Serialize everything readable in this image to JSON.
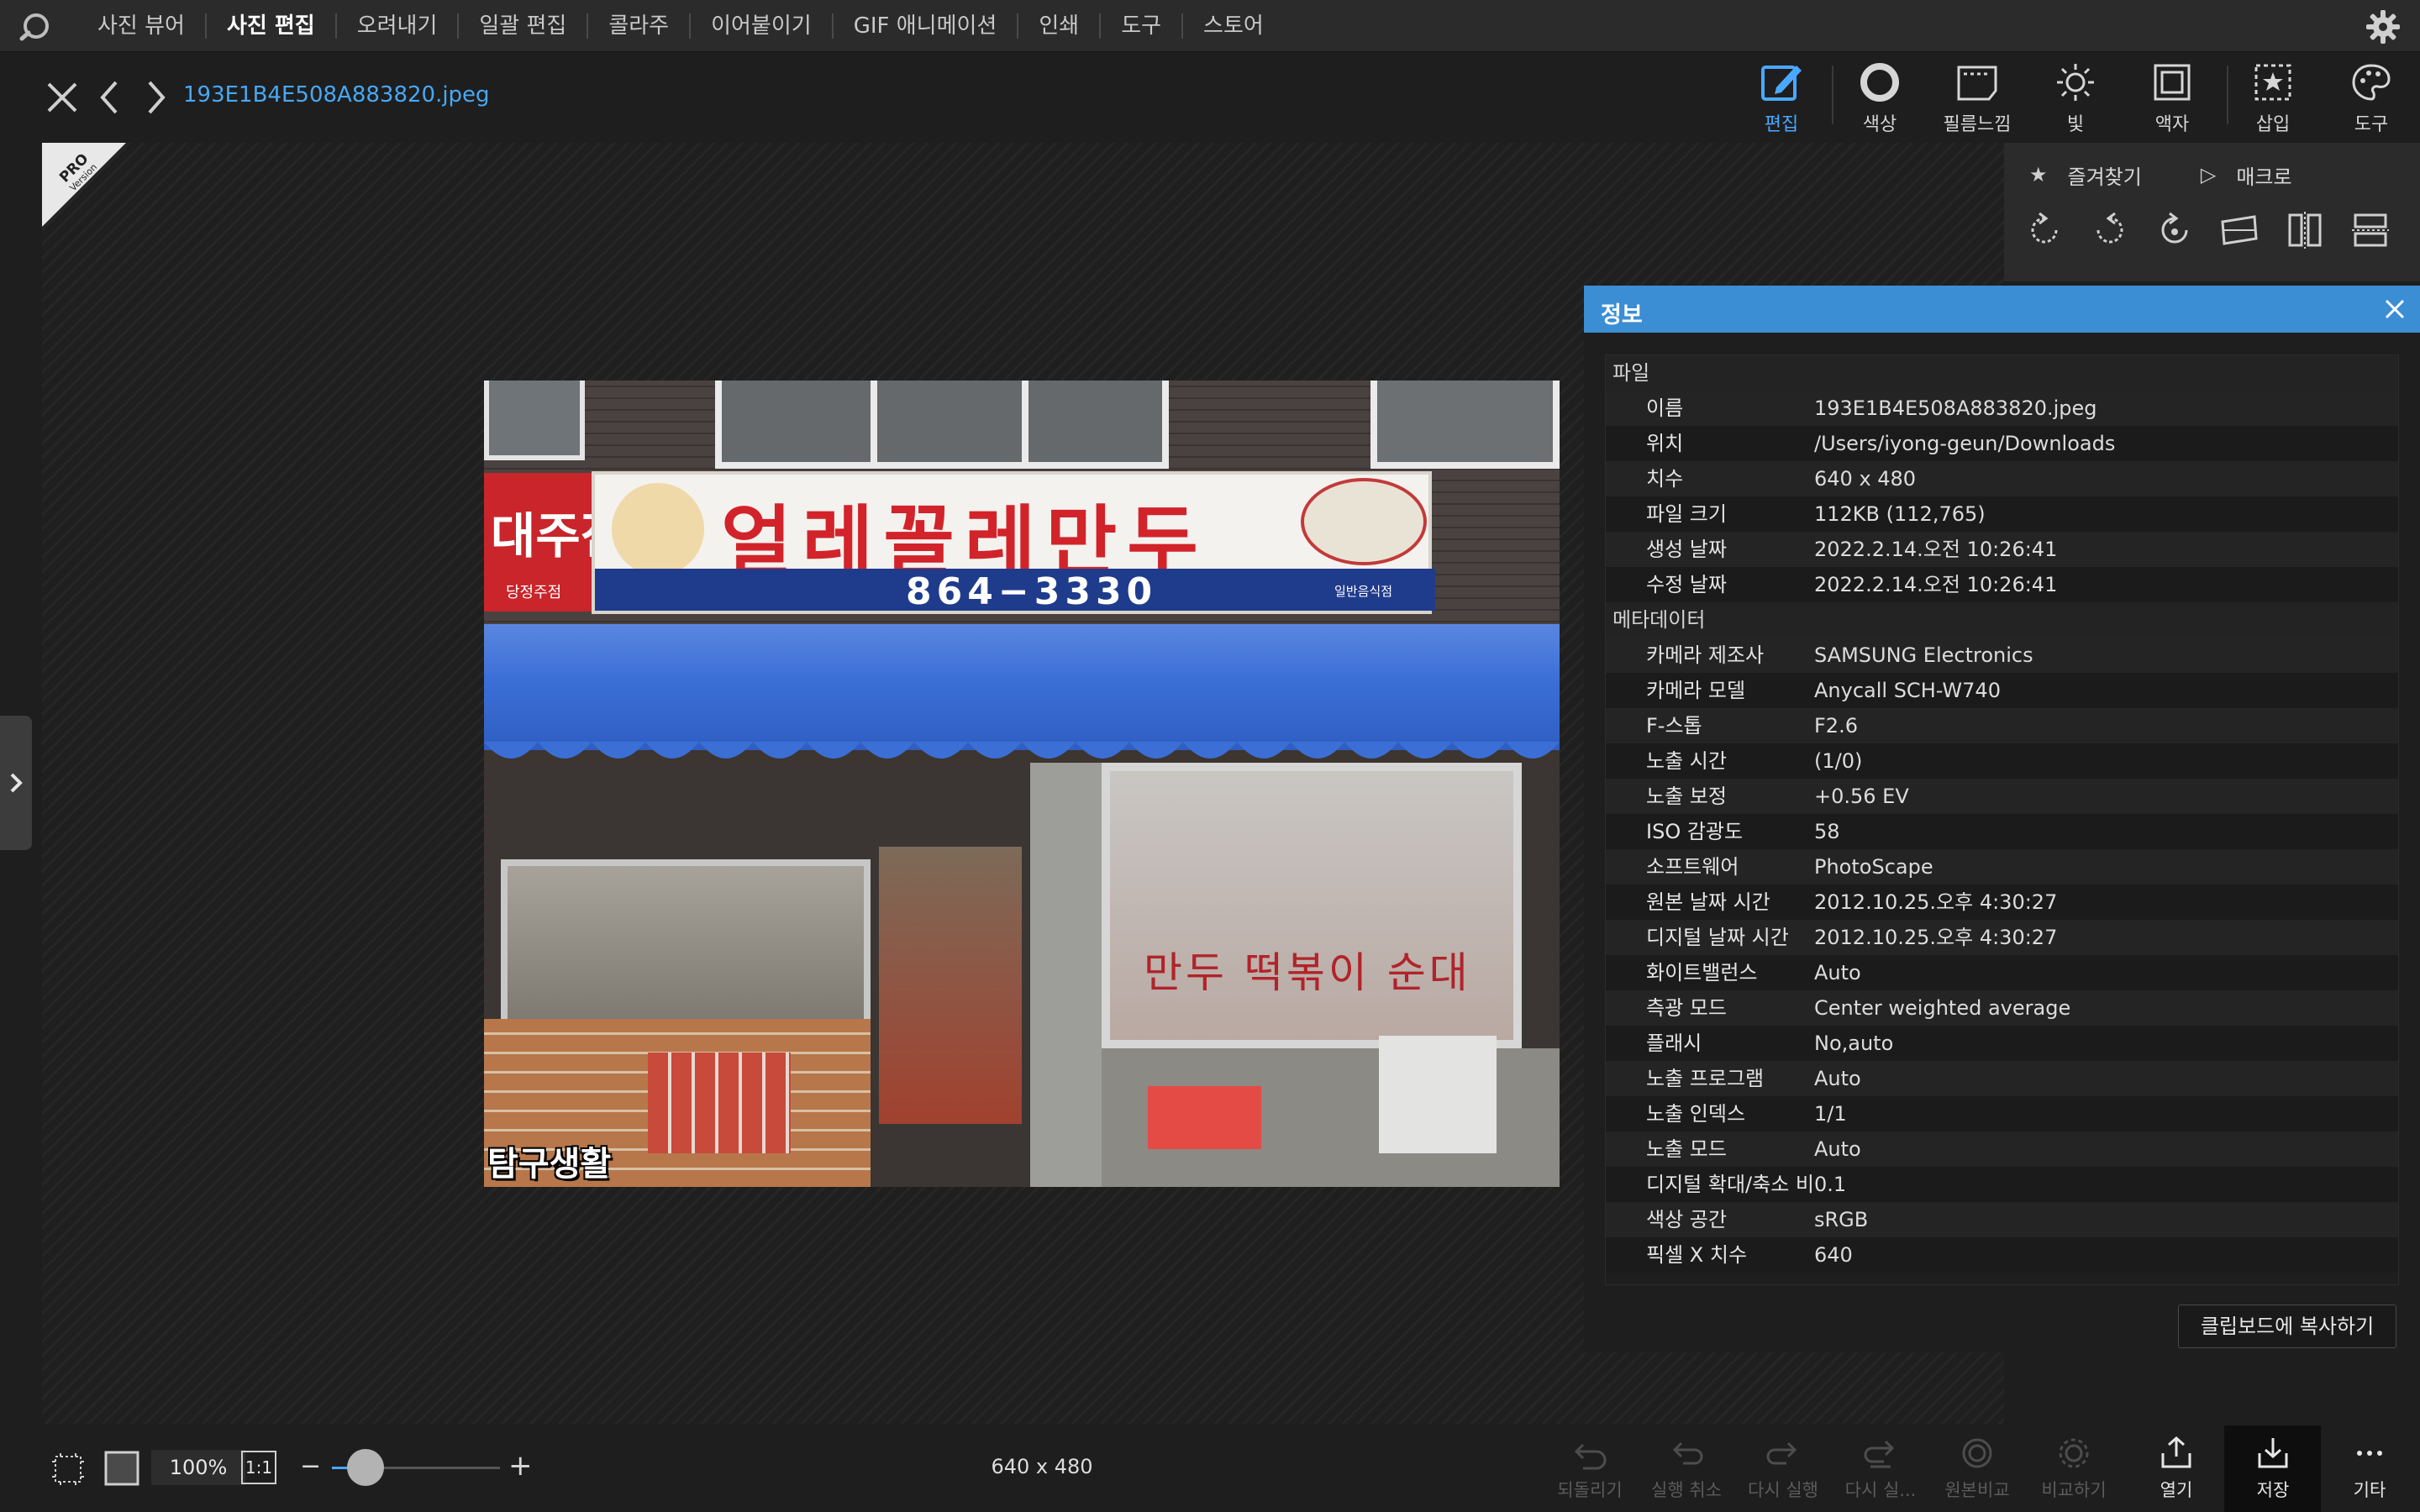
{
  "app": {
    "menu": [
      "사진 뷰어",
      "사진 편집",
      "오려내기",
      "일괄 편집",
      "콜라주",
      "이어붙이기",
      "GIF 애니메이션",
      "인쇄",
      "도구",
      "스토어"
    ],
    "active_menu": "사진 편집"
  },
  "header": {
    "filename": "193E1B4E508A883820.jpeg",
    "tools": [
      {
        "label": "편집",
        "icon": "edit-icon"
      },
      {
        "label": "색상",
        "icon": "color-circle-icon"
      },
      {
        "label": "필름느낌",
        "icon": "film-icon"
      },
      {
        "label": "빛",
        "icon": "sun-icon"
      },
      {
        "label": "액자",
        "icon": "frame-icon"
      },
      {
        "label": "삽입",
        "icon": "insert-icon"
      },
      {
        "label": "도구",
        "icon": "palette-icon"
      }
    ]
  },
  "badge": {
    "top": "PRO",
    "bottom": "Version"
  },
  "side": {
    "favorites": "즐겨찾기",
    "macro": "매크로"
  },
  "photo_text": {
    "sign_main": "얼레꼴레만두",
    "sign_left": "대주점",
    "sign_left_sub": "당정주점",
    "phone": "864−3330",
    "sign_right_sub": "일반음식점",
    "window_text": "만두 떡볶이 순대",
    "watermark": "탐구생활"
  },
  "info": {
    "title": "정보",
    "section_file": "파일",
    "file_rows": [
      {
        "k": "이름",
        "v": "193E1B4E508A883820.jpeg"
      },
      {
        "k": "위치",
        "v": "/Users/iyong-geun/Downloads"
      },
      {
        "k": "치수",
        "v": "640 x 480"
      },
      {
        "k": "파일 크기",
        "v": "112KB (112,765)"
      },
      {
        "k": "생성 날짜",
        "v": "2022.2.14.오전 10:26:41"
      },
      {
        "k": "수정 날짜",
        "v": "2022.2.14.오전 10:26:41"
      }
    ],
    "section_meta": "메타데이터",
    "meta_rows": [
      {
        "k": "카메라 제조사",
        "v": "SAMSUNG Electronics"
      },
      {
        "k": "카메라 모델",
        "v": "Anycall SCH-W740"
      },
      {
        "k": "F-스톱",
        "v": "F2.6"
      },
      {
        "k": "노출 시간",
        "v": "(1/0)"
      },
      {
        "k": "노출 보정",
        "v": "+0.56 EV"
      },
      {
        "k": "ISO 감광도",
        "v": "58"
      },
      {
        "k": "소프트웨어",
        "v": "PhotoScape"
      },
      {
        "k": "원본 날짜 시간",
        "v": "2012.10.25.오후 4:30:27"
      },
      {
        "k": "디지털 날짜 시간",
        "v": "2012.10.25.오후 4:30:27"
      },
      {
        "k": "화이트밸런스",
        "v": "Auto"
      },
      {
        "k": "측광 모드",
        "v": "Center weighted average"
      },
      {
        "k": "플래시",
        "v": "No,auto"
      },
      {
        "k": "노출 프로그램",
        "v": "Auto"
      },
      {
        "k": "노출 인덱스",
        "v": "1/1"
      },
      {
        "k": "노출 모드",
        "v": "Auto"
      },
      {
        "k": "디지털 확대/축소 비율",
        "v": "0.1"
      },
      {
        "k": "색상 공간",
        "v": "sRGB"
      },
      {
        "k": "픽셀 X 치수",
        "v": "640"
      }
    ],
    "copy_button": "클립보드에 복사하기"
  },
  "bottom": {
    "zoom": "100%",
    "one_to_one": "1:1",
    "zoom_minus": "−",
    "zoom_plus": "+",
    "zoom_level": 0.2,
    "dimensions": "640 x 480",
    "buttons": [
      {
        "label": "되돌리기",
        "icon": "revert-icon",
        "enabled": false
      },
      {
        "label": "실행 취소",
        "icon": "undo-icon",
        "enabled": false
      },
      {
        "label": "다시 실행",
        "icon": "redo-icon",
        "enabled": false
      },
      {
        "label": "다시 실...",
        "icon": "redo-all-icon",
        "enabled": false
      },
      {
        "label": "원본비교",
        "icon": "compare-icon",
        "enabled": false
      },
      {
        "label": "비교하기",
        "icon": "compare-dashed-icon",
        "enabled": false
      },
      {
        "label": "열기",
        "icon": "open-icon",
        "enabled": true
      },
      {
        "label": "저장",
        "icon": "save-icon",
        "enabled": true
      },
      {
        "label": "기타",
        "icon": "more-icon",
        "enabled": true
      }
    ]
  },
  "colors": {
    "accent": "#4aa8ff",
    "info_header": "#3b8ed4",
    "awning": "#3b6fd6"
  }
}
